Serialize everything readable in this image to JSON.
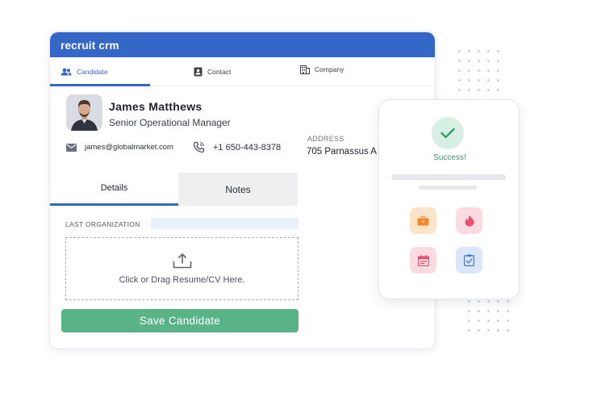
{
  "app": {
    "title": "recruit crm"
  },
  "tabs": [
    {
      "label": "Candidate",
      "icon": "users-icon",
      "active": true
    },
    {
      "label": "Contact",
      "icon": "contact-card-icon"
    },
    {
      "label": "Company",
      "icon": "building-icon"
    }
  ],
  "candidate": {
    "name": "James Matthews",
    "role": "Senior Operational Manager",
    "email": "james@globalmarket.com",
    "phone": "+1 650-443-8378",
    "address_label": "ADDRESS",
    "address_value": "705 Parnassus A"
  },
  "subtabs": [
    {
      "label": "Details",
      "active": true
    },
    {
      "label": "Notes"
    }
  ],
  "form": {
    "last_org_label": "LAST ORGANIZATION",
    "dropzone_text": "Click or Drag Resume/CV Here.",
    "save_label": "Save Candidate"
  },
  "success_panel": {
    "status": "Success!",
    "tiles": [
      "briefcase-icon",
      "flame-icon",
      "calendar-icon",
      "clipboard-check-icon"
    ]
  },
  "colors": {
    "brand": "#3567c9",
    "save": "#58b386",
    "success": "#3c9e6f"
  }
}
